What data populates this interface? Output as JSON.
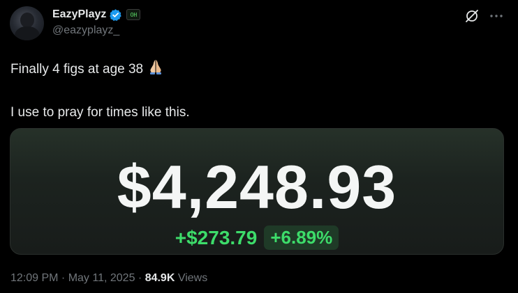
{
  "author": {
    "display_name": "EazyPlayz",
    "handle": "@eazyplayz_",
    "affiliate_badge": "OH"
  },
  "tweet": {
    "line1": "Finally 4 figs at age 38",
    "line2": "I use to pray for times like this."
  },
  "card": {
    "balance": "$4,248.93",
    "change_amount": "+$273.79",
    "change_percent": "+6.89%"
  },
  "meta": {
    "time": "12:09 PM",
    "sep1": " · ",
    "date": "May 11, 2025",
    "sep2": " · ",
    "views_count": "84.9K",
    "views_label": "Views"
  },
  "colors": {
    "verified": "#1d9bf0",
    "gain": "#3ddc6a",
    "muted": "#71767b"
  },
  "icons": [
    "verified-badge-icon",
    "affiliate-badge-icon",
    "grok-icon",
    "more-icon",
    "praying-hands-icon"
  ]
}
